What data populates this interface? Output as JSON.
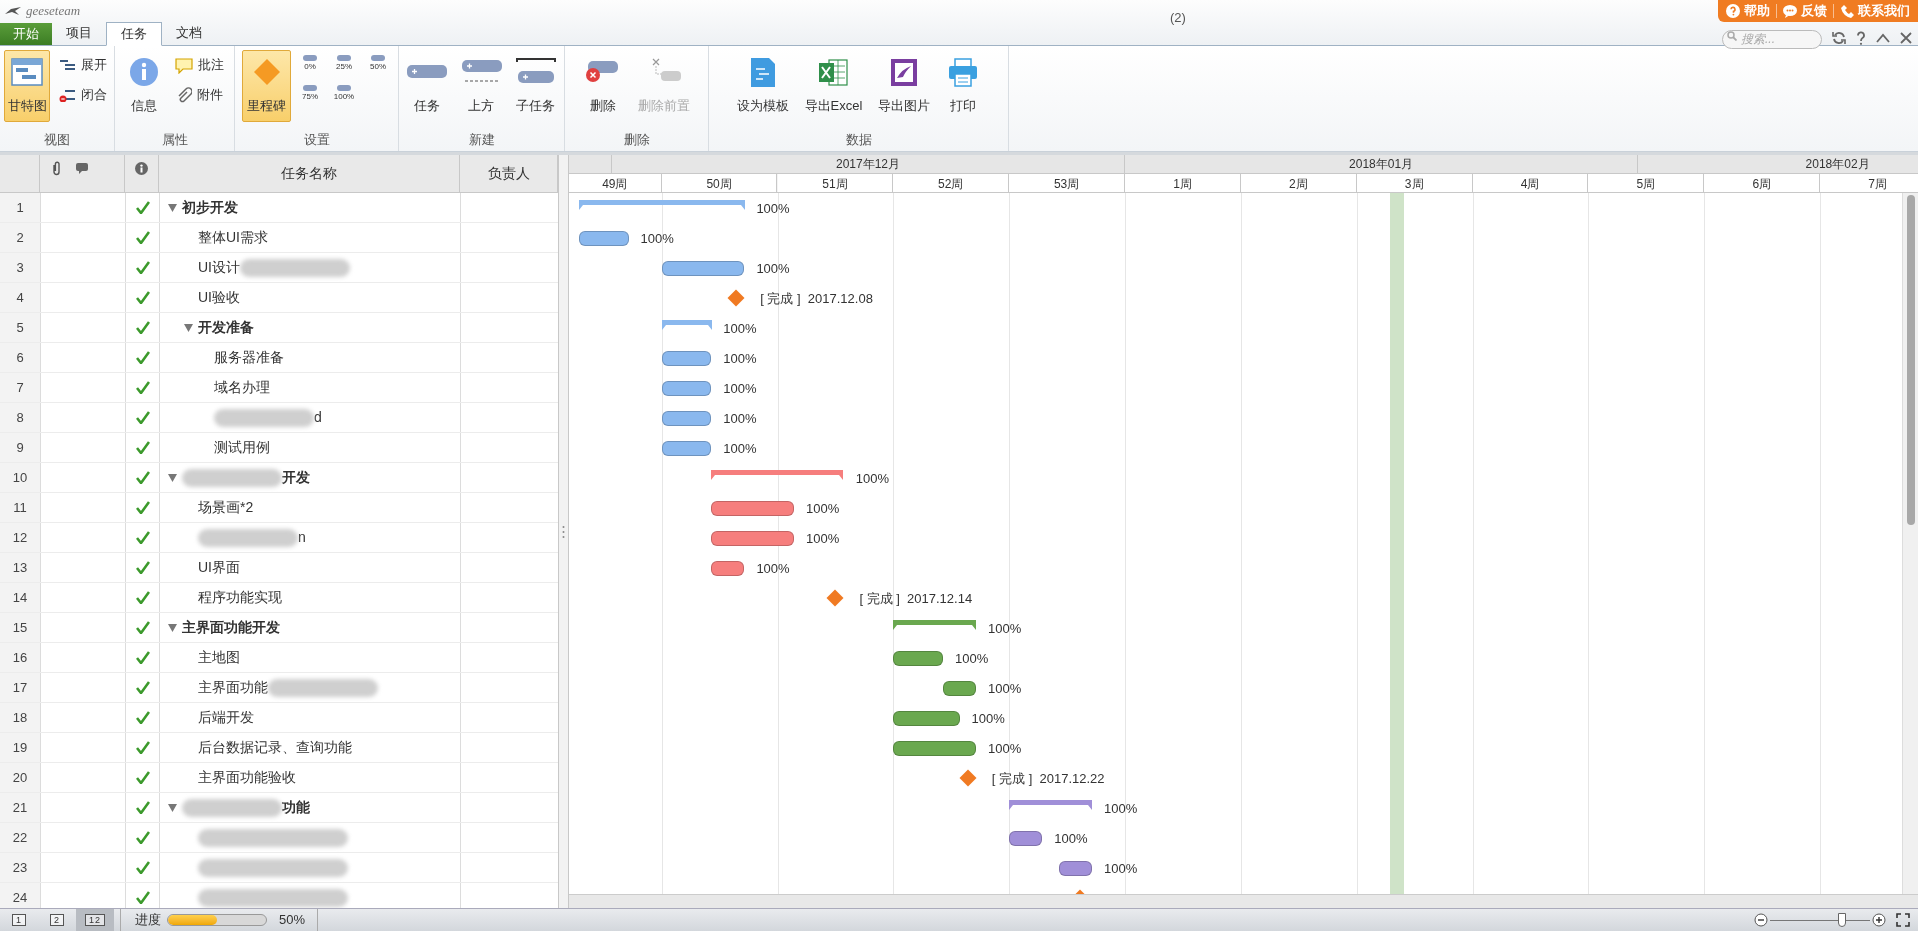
{
  "app": {
    "logo": "geeseteam",
    "title": "(2)"
  },
  "help_links": [
    {
      "label": "帮助"
    },
    {
      "label": "反馈"
    },
    {
      "label": "联系我们"
    }
  ],
  "search": {
    "placeholder": "搜索..."
  },
  "tabs": [
    {
      "label": "开始",
      "selected": false,
      "kind": "start"
    },
    {
      "label": "项目",
      "selected": false,
      "kind": "tab"
    },
    {
      "label": "任务",
      "selected": true,
      "kind": "tab"
    },
    {
      "label": "文档",
      "selected": false,
      "kind": "tab"
    }
  ],
  "ribbon": [
    {
      "label": "视图",
      "items": [
        {
          "kind": "large",
          "label": "甘特图",
          "selected": true
        },
        {
          "kind": "small",
          "label": "展开",
          "selected": false
        },
        {
          "kind": "small",
          "label": "闭合",
          "selected": false
        }
      ]
    },
    {
      "label": "属性",
      "items": [
        {
          "kind": "large",
          "label": "信息"
        },
        {
          "kind": "small",
          "label": "批注"
        },
        {
          "kind": "small",
          "label": "附件"
        }
      ]
    },
    {
      "label": "设置",
      "items": [
        {
          "kind": "large",
          "label": "里程碑",
          "selected": true
        }
      ],
      "presets": [
        {
          "label": "0%"
        },
        {
          "label": "25%"
        },
        {
          "label": "50%"
        },
        {
          "label": "75%"
        },
        {
          "label": "100%"
        }
      ]
    },
    {
      "label": "新建",
      "items": [
        {
          "kind": "large",
          "label": "任务"
        },
        {
          "kind": "large",
          "label": "上方"
        },
        {
          "kind": "large",
          "label": "子任务"
        }
      ]
    },
    {
      "label": "删除",
      "items": [
        {
          "kind": "large",
          "label": "删除",
          "disabled": false
        },
        {
          "kind": "large",
          "label": "删除前置",
          "disabled": true
        }
      ]
    },
    {
      "label": "数据",
      "items": [
        {
          "kind": "large",
          "label": "设为模板"
        },
        {
          "kind": "large",
          "label": "导出Excel"
        },
        {
          "kind": "large",
          "label": "导出图片"
        },
        {
          "kind": "large",
          "label": "打印"
        }
      ]
    }
  ],
  "table": {
    "columns": [
      {
        "kind": "attach"
      },
      {
        "kind": "info"
      },
      {
        "kind": "text",
        "label": "任务名称"
      },
      {
        "kind": "text",
        "label": "负责人"
      }
    ]
  },
  "timeline": {
    "months": [
      "2017年12月",
      "2018年01月",
      "2018年02月"
    ],
    "weeks": [
      "49周",
      "50周",
      "51周",
      "52周",
      "53周",
      "1周",
      "2周",
      "3周",
      "4周",
      "5周",
      "6周",
      "7周"
    ]
  },
  "tasks": [
    {
      "num": "1",
      "name": "初步开发",
      "kind": "summary",
      "done": true,
      "expanded": true,
      "color": "#8ab8ee",
      "bar_label": "100%",
      "children": [
        {
          "num": "2",
          "name": "整体UI需求",
          "kind": "task",
          "done": true,
          "bar_label": "100%"
        },
        {
          "num": "3",
          "name": "UI设计",
          "kind": "task",
          "done": true,
          "bar_label": "100%"
        },
        {
          "num": "4",
          "name": "UI验收",
          "kind": "milestone",
          "done": true,
          "bar_label": "[ 完成 ]  2017.12.08"
        },
        {
          "num": "5",
          "name": "开发准备",
          "kind": "summary",
          "done": true,
          "expanded": true,
          "bar_label": "100%",
          "children": [
            {
              "num": "6",
              "name": "服务器准备",
              "kind": "task",
              "done": true,
              "bar_label": "100%"
            },
            {
              "num": "7",
              "name": "域名办理",
              "kind": "task",
              "done": true,
              "bar_label": "100%"
            },
            {
              "num": "8",
              "name": "d",
              "kind": "task",
              "done": true,
              "bar_label": "100%"
            },
            {
              "num": "9",
              "name": "测试用例",
              "kind": "task",
              "done": true,
              "bar_label": "100%"
            }
          ]
        }
      ]
    },
    {
      "num": "10",
      "name": "开发",
      "kind": "summary",
      "done": true,
      "expanded": true,
      "color": "#f67e7d",
      "bar_label": "100%",
      "children": [
        {
          "num": "11",
          "name": "场景画*2",
          "kind": "task",
          "done": true,
          "bar_label": "100%"
        },
        {
          "num": "12",
          "name": "n",
          "kind": "task",
          "done": true,
          "bar_label": "100%"
        },
        {
          "num": "13",
          "name": "UI界面",
          "kind": "task",
          "done": true,
          "bar_label": "100%"
        },
        {
          "num": "14",
          "name": "程序功能实现",
          "kind": "milestone",
          "done": true,
          "bar_label": "[ 完成 ]  2017.12.14"
        }
      ]
    },
    {
      "num": "15",
      "name": "主界面功能开发",
      "kind": "summary",
      "done": true,
      "expanded": true,
      "color": "#6aa84f",
      "bar_label": "100%",
      "children": [
        {
          "num": "16",
          "name": "主地图",
          "kind": "task",
          "done": true,
          "bar_label": "100%"
        },
        {
          "num": "17",
          "name": "主界面功能",
          "kind": "task",
          "done": true,
          "bar_label": "100%"
        },
        {
          "num": "18",
          "name": "后端开发",
          "kind": "task",
          "done": true,
          "bar_label": "100%"
        },
        {
          "num": "19",
          "name": "后台数据记录、查询功能",
          "kind": "task",
          "done": true,
          "bar_label": "100%"
        },
        {
          "num": "20",
          "name": "主界面功能验收",
          "kind": "milestone",
          "done": true,
          "bar_label": "[ 完成 ]  2017.12.22"
        }
      ]
    },
    {
      "num": "21",
      "name": "功能",
      "kind": "summary",
      "done": true,
      "expanded": true,
      "color": "#a08fd8",
      "bar_label": "100%",
      "children": [
        {
          "num": "22",
          "kind": "task",
          "done": true,
          "bar_label": "100%"
        },
        {
          "num": "23",
          "kind": "task",
          "done": true,
          "bar_label": "100%"
        },
        {
          "num": "24",
          "kind": "milestone",
          "done": true
        }
      ]
    }
  ],
  "status_bar": {
    "views": [
      {
        "label": "1",
        "selected": false
      },
      {
        "label": "2",
        "selected": false
      },
      {
        "label": "12",
        "selected": true
      }
    ],
    "progress_label": "进度",
    "progress": {
      "level": 0.5
    },
    "progress_text": "50%",
    "zoom": {
      "level": 0.72
    }
  }
}
